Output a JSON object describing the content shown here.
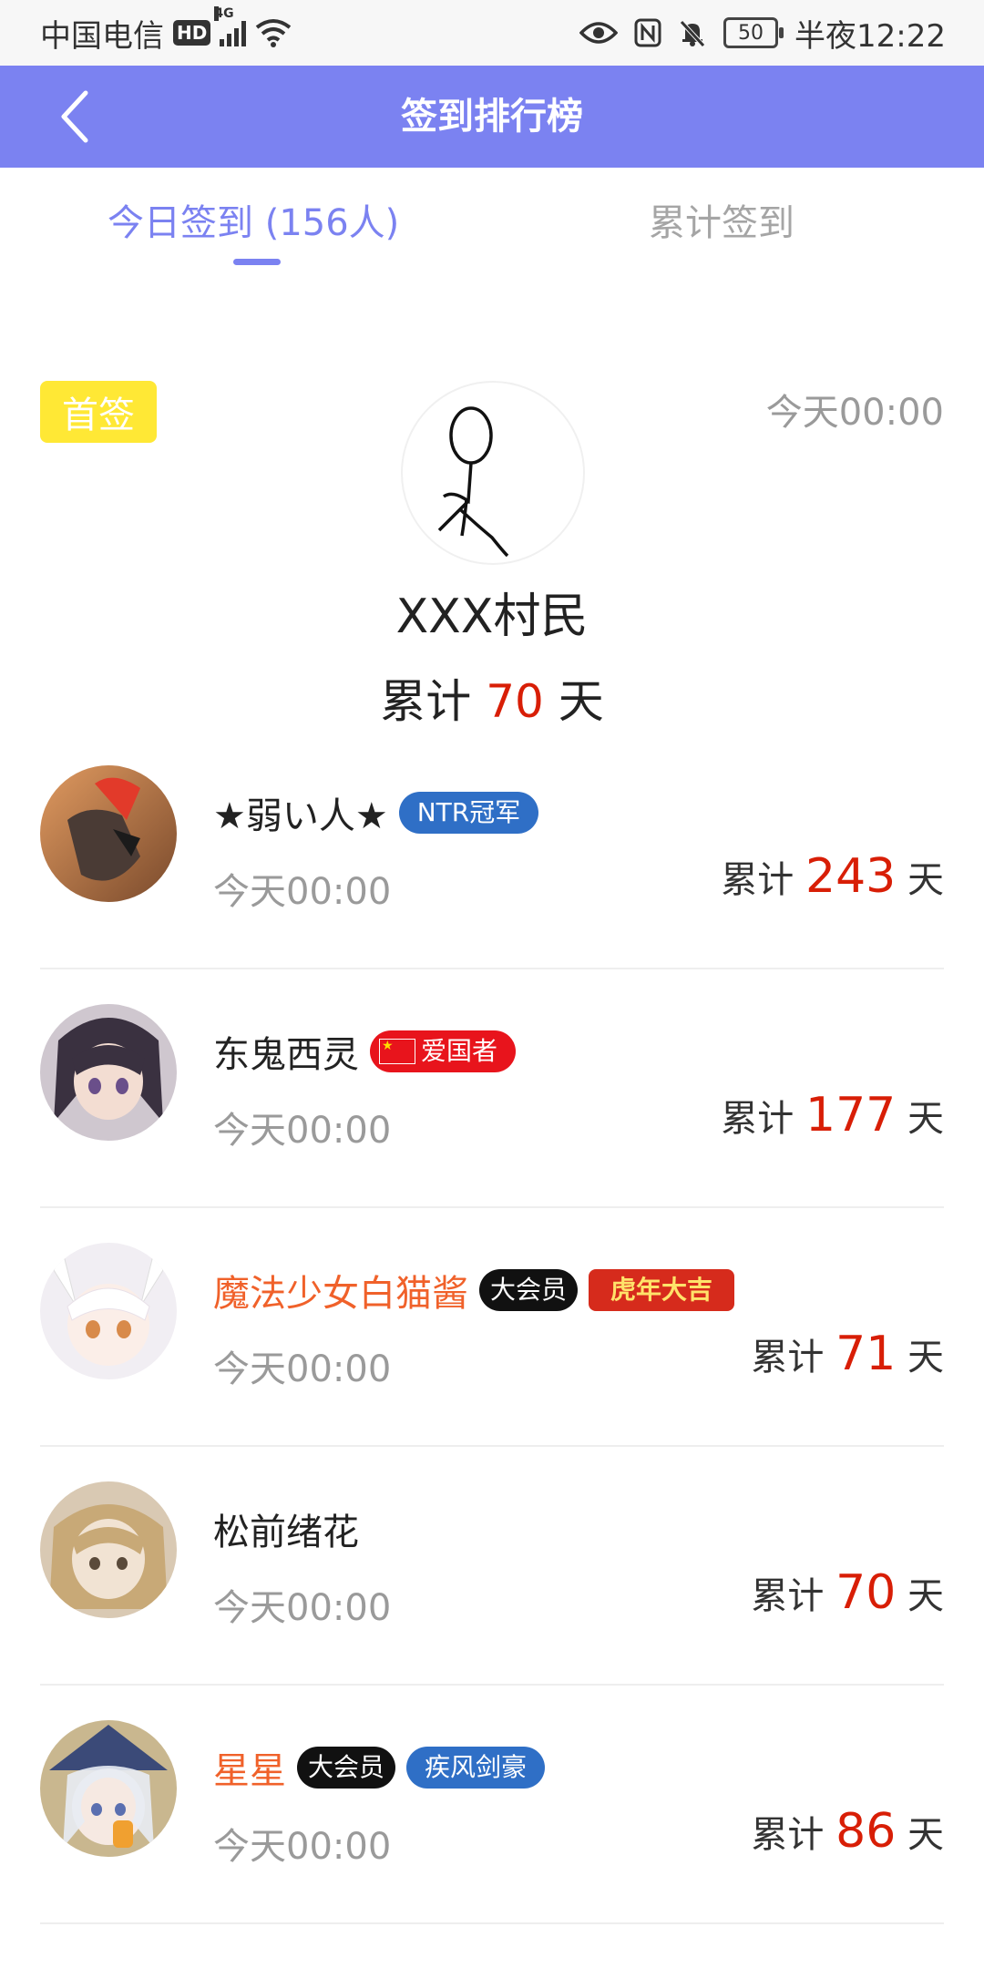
{
  "status_bar": {
    "carrier": "中国电信",
    "hd": "HD",
    "network": "4G",
    "battery": "50",
    "time": "半夜12:22"
  },
  "header": {
    "title": "签到排行榜"
  },
  "tabs": {
    "today": "今日签到 (156人)",
    "total": "累计签到"
  },
  "first_sign": {
    "badge": "首签",
    "time": "今天00:00",
    "name": "XXX村民",
    "prefix": "累计",
    "days": "70",
    "suffix": "天"
  },
  "ranking": [
    {
      "name": "★弱い人★",
      "badges": [
        "NTR冠军"
      ],
      "time": "今天00:00",
      "prefix": "累计",
      "days": "243",
      "suffix": "天"
    },
    {
      "name": "东鬼西灵",
      "badges": [
        "爱国者"
      ],
      "time": "今天00:00",
      "prefix": "累计",
      "days": "177",
      "suffix": "天"
    },
    {
      "name": "魔法少女白猫酱",
      "badges": [
        "大会员",
        "虎年大吉"
      ],
      "time": "今天00:00",
      "prefix": "累计",
      "days": "71",
      "suffix": "天"
    },
    {
      "name": "松前绪花",
      "badges": [],
      "time": "今天00:00",
      "prefix": "累计",
      "days": "70",
      "suffix": "天"
    },
    {
      "name": "星星",
      "badges": [
        "大会员",
        "疾风剑豪"
      ],
      "time": "今天00:00",
      "prefix": "累计",
      "days": "86",
      "suffix": "天"
    }
  ],
  "colors": {
    "primary": "#7b82f1",
    "highlight": "#d81e06",
    "vip_name": "#f0612a",
    "first_badge": "#ffe835"
  }
}
